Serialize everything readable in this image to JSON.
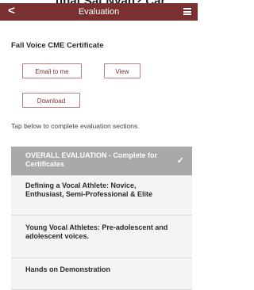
{
  "top_banner": {
    "text": "uhat Sat Nyan? Car"
  },
  "navbar": {
    "back_glyph": "<",
    "title": "Evaluation",
    "menu_icon": "hamburger-menu-icon",
    "background_color": "#7a2f31"
  },
  "certificate": {
    "title": "Fall Voice CME Certificate",
    "email_button_label": "Email to me",
    "view_button_label": "View",
    "download_button_label": "Download"
  },
  "instructions": "Tap below to complete evaluation sections.",
  "sections": [
    {
      "label": "OVERALL EVALUATION - Complete for Certificates",
      "icon": "checkmark-icon",
      "icon_glyph": "✓"
    },
    {
      "label": "Defining a Vocal Athlete: Novice, Enthusiast, Semi-Professional & Elite",
      "icon": "arrow-right-icon",
      "icon_glyph": "→"
    },
    {
      "label": "Young Vocal Athletes: Pre-adolescent and adolescent voices.",
      "icon": "arrow-right-icon",
      "icon_glyph": "→"
    },
    {
      "label": "Hands on Demonstration",
      "icon": "arrow-right-icon",
      "icon_glyph": "→"
    }
  ]
}
